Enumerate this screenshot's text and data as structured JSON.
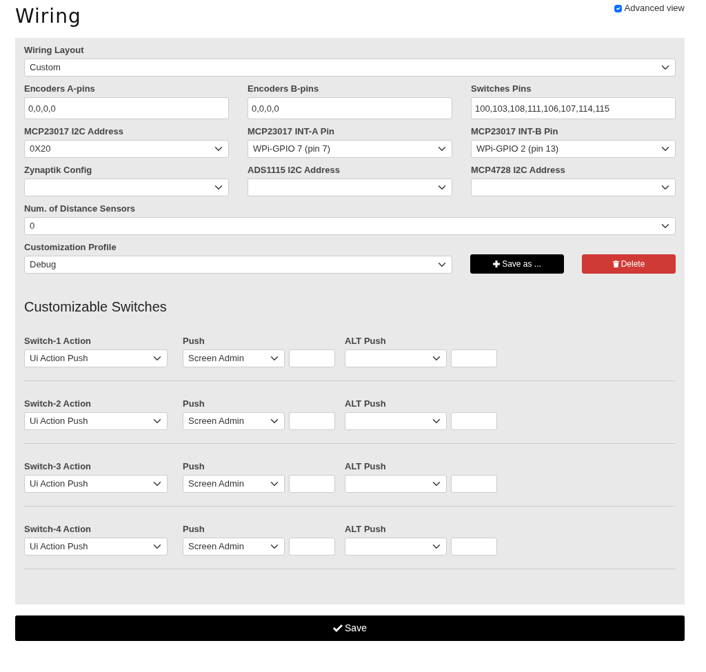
{
  "title": "Wiring",
  "advanced_view": {
    "label": "Advanced view",
    "checked": true
  },
  "wiring_layout": {
    "label": "Wiring Layout",
    "value": "Custom"
  },
  "field_rows": [
    [
      {
        "kind": "input",
        "label": "Encoders A-pins",
        "value": "0,0,0,0"
      },
      {
        "kind": "input",
        "label": "Encoders B-pins",
        "value": "0,0,0,0"
      },
      {
        "kind": "input",
        "label": "Switches Pins",
        "value": "100,103,108,111,106,107,114,115"
      }
    ],
    [
      {
        "kind": "select",
        "label": "MCP23017 I2C Address",
        "value": "0X20"
      },
      {
        "kind": "select",
        "label": "MCP23017 INT-A Pin",
        "value": "WPi-GPIO 7 (pin 7)"
      },
      {
        "kind": "select",
        "label": "MCP23017 INT-B Pin",
        "value": "WPi-GPIO 2 (pin 13)"
      }
    ],
    [
      {
        "kind": "select",
        "label": "Zynaptik Config"
      },
      {
        "kind": "select",
        "label": "ADS1115 I2C Address"
      },
      {
        "kind": "select",
        "label": "MCP4728 I2C Address"
      }
    ]
  ],
  "distance_sensors": {
    "label": "Num. of Distance Sensors",
    "value": "0"
  },
  "profile": {
    "label": "Customization Profile",
    "value": "Debug",
    "save_as_button": "Save as ...",
    "delete_button": "Delete"
  },
  "switches_heading": "Customizable Switches",
  "switches": [
    {
      "action_label": "Switch-1 Action",
      "action": "Ui Action Push",
      "push_label": "Push",
      "push": "Screen Admin",
      "alt_push_label": "ALT Push"
    },
    {
      "action_label": "Switch-2 Action",
      "action": "Ui Action Push",
      "push_label": "Push",
      "push": "Screen Admin",
      "alt_push_label": "ALT Push"
    },
    {
      "action_label": "Switch-3 Action",
      "action": "Ui Action Push",
      "push_label": "Push",
      "push": "Screen Admin",
      "alt_push_label": "ALT Push"
    },
    {
      "action_label": "Switch-4 Action",
      "action": "Ui Action Push",
      "push_label": "Push",
      "push": "Screen Admin",
      "alt_push_label": "ALT Push"
    }
  ],
  "save_button": "Save"
}
